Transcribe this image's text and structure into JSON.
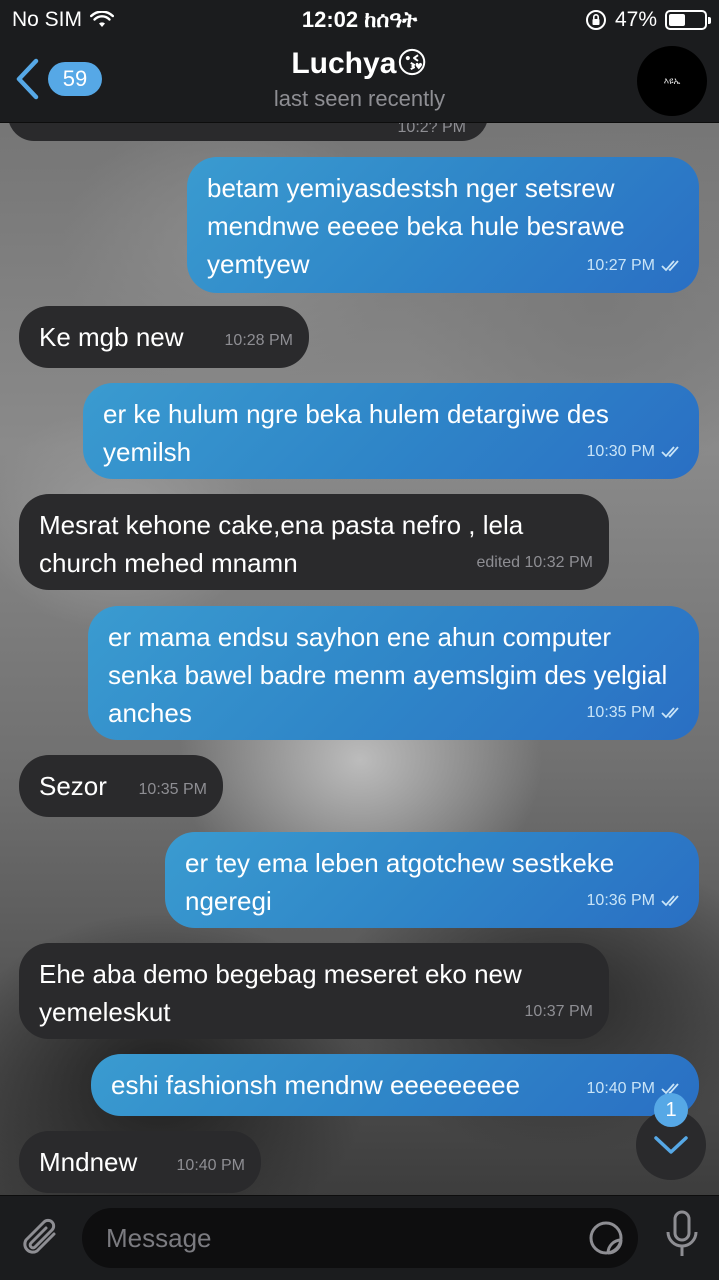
{
  "status_bar": {
    "carrier": "No SIM",
    "time": "12:02 ከሰዓት",
    "battery_percent": "47%",
    "battery_level": 0.47
  },
  "header": {
    "back_count": "59",
    "title": "Luchya😘",
    "subtitle": "last seen recently",
    "avatar_text": "እዩኤ"
  },
  "partial_message": {
    "time": "10:2? PM"
  },
  "messages": [
    {
      "dir": "out",
      "text": "betam yemiyasdestsh nger setsrew mendnwe eeeee beka hule besrawe yemtyew",
      "time": "10:27 PM",
      "read": true
    },
    {
      "dir": "in",
      "text": "Ke mgb new",
      "time": "10:28 PM"
    },
    {
      "dir": "out",
      "text": "er ke hulum ngre beka hulem detargiwe des yemilsh",
      "time": "10:30 PM",
      "read": true
    },
    {
      "dir": "in",
      "text": "Mesrat kehone cake,ena pasta nefro , lela church mehed mnamn",
      "time": "edited 10:32 PM"
    },
    {
      "dir": "out",
      "text": "er mama endsu sayhon ene ahun computer senka bawel badre menm ayemslgim des yelgial anches",
      "time": "10:35 PM",
      "read": true
    },
    {
      "dir": "in",
      "text": "Sezor",
      "time": "10:35 PM"
    },
    {
      "dir": "out",
      "text": "er tey ema leben atgotchew sestkeke ngeregi",
      "time": "10:36 PM",
      "read": true
    },
    {
      "dir": "in",
      "text": "Ehe aba demo begebag meseret eko new yemeleskut",
      "time": "10:37 PM"
    },
    {
      "dir": "out",
      "text": "eshi fashionsh mendnw eeeeeeeee",
      "time": "10:40 PM",
      "read": true
    },
    {
      "dir": "in",
      "text": "Mndnew",
      "time": "10:40 PM"
    }
  ],
  "scroll_down": {
    "unread_count": "1"
  },
  "input": {
    "placeholder": "Message"
  }
}
